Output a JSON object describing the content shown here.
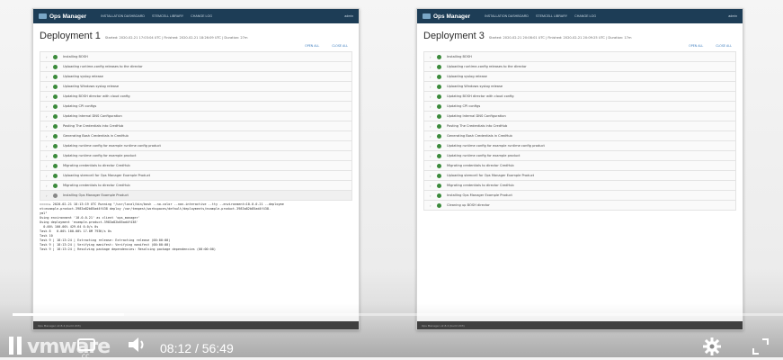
{
  "ops_manager": {
    "brand": "Ops Manager",
    "nav": [
      "INSTALLATION DASHBOARD",
      "STEMCELL LIBRARY",
      "CHANGE LOG"
    ],
    "user": "admin"
  },
  "deployment_left": {
    "title": "Deployment 1",
    "meta": "Started: 2020-02-21 17:03:04 UTC | Finished: 2020-02-21 18:26:09 UTC | Duration: 27m",
    "actions": [
      "OPEN ALL",
      "CLOSE ALL"
    ],
    "steps": [
      "Installing BOSH",
      "Uploading runtime-config releases to the director",
      "Uploading syslog release",
      "Uploading Windows syslog release",
      "Updating BOSH director with cloud config",
      "Updating CPI configs",
      "Updating Internal DNS Configuration",
      "Posting The Credentials into CredHub",
      "Generating Bosh Credentials in CredHub",
      "Updating runtime config for example runtime config product",
      "Updating runtime config for example product",
      "Migrating credentials to director CredHub",
      "Uploading stemcell for Ops Manager Example Product",
      "Migrating credentials to director CredHub",
      "Installing Ops Manager Example Product"
    ],
    "log": [
      "=====+ 2020-02-21 18:13:19 UTC Running \"/usr/local/bin/bosh --no-color --non-interactive --tty --environment=10.0.0.21 --deployme",
      "nt=example-product-3983a82b85ad4f438 deploy /var/tempest/workspaces/default/deployments/example-product-3983a82b85ad4f438.",
      "yml\"",
      "Using environment '10.0.0.21' as client 'ops_manager'",
      "",
      "Using deployment 'example-product-3983a82b85ad4f438'",
      "",
      "  0.00% 100.00% 429.64 0.0/s 0s",
      "Task 8   0.00% 100.00% 17.8M 793K/s 0s",
      "",
      "Task 10",
      "Task 9 | 18:13:24 | Extracting release: Extracting release (00:00:00)",
      "Task 9 | 18:13:24 | Verifying manifest: Verifying manifest (00:00:00)",
      "Task 9 | 18:13:24 | Resolving package dependencies: Resolving package dependencies (00:00:00)"
    ],
    "footer": "Ops Manager v2.8.4 (build 203)"
  },
  "deployment_right": {
    "title": "Deployment 3",
    "meta": "Started: 2020-02-21 20:08:01 UTC | Finished: 2020-02-21 20:09:25 UTC | Duration: 17m",
    "actions": [
      "OPEN ALL",
      "CLOSE ALL"
    ],
    "steps": [
      "Installing BOSH",
      "Uploading runtime-config releases to the director",
      "Uploading syslog release",
      "Uploading Windows syslog release",
      "Updating BOSH director with cloud config",
      "Updating CPI configs",
      "Updating Internal DNS Configuration",
      "Posting The Credentials into CredHub",
      "Generating Bosh Credentials in CredHub",
      "Updating runtime config for example runtime config product",
      "Updating runtime config for example product",
      "Migrating credentials to director CredHub",
      "Uploading stemcell for Ops Manager Example Product",
      "Migrating credentials to director CredHub",
      "Installing Ops Manager Example Product",
      "Cleaning up BOSH director"
    ],
    "footer": "Ops Manager v2.8.4 (build 203)"
  },
  "player": {
    "time_current": "08:12",
    "time_separator": "/",
    "time_total": "56:49",
    "progress_fraction": 0.1445,
    "watermark": "vmware",
    "cc_label": "CC"
  }
}
